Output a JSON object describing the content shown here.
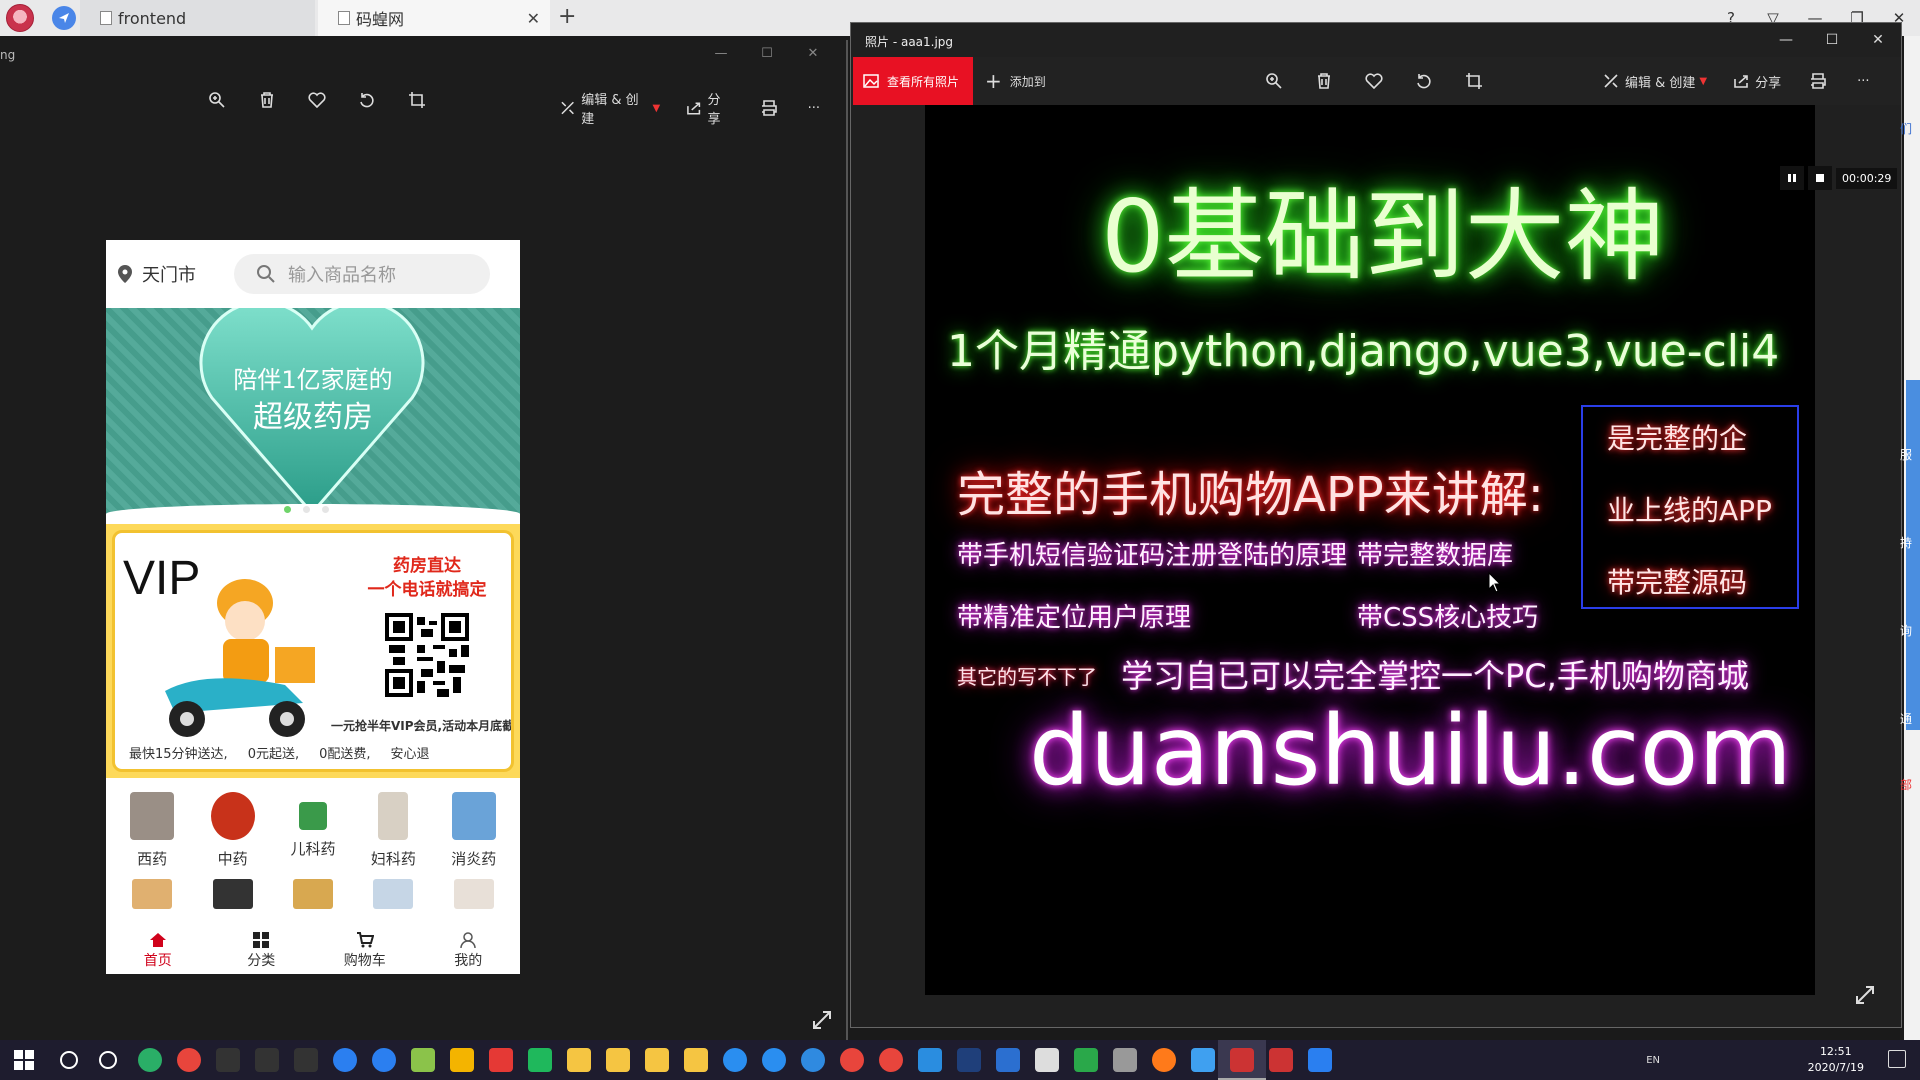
{
  "browser": {
    "tabs": [
      {
        "label": "frontend"
      },
      {
        "label": "码蝗网"
      }
    ],
    "close_label": "✕",
    "new_tab_label": "+"
  },
  "left_window": {
    "title_fragment": "ng",
    "toolbar": {
      "edit_create": "编辑 & 创建",
      "share": "分享",
      "more": "···"
    },
    "phone": {
      "location": "天门市",
      "search_placeholder": "输入商品名称",
      "banner_line1": "陪伴1亿家庭的",
      "banner_line2": "超级药房",
      "vip": {
        "title": "VIP",
        "headline1": "药房直达",
        "headline2": "一个电话就搞定",
        "promo": "一元抢半年VIP会员,活动本月底截止",
        "perks": [
          "最快15分钟送达,",
          "0元起送,",
          "0配送费,",
          "安心退"
        ]
      },
      "categories": [
        {
          "label": "西药",
          "color": "#9a8f86"
        },
        {
          "label": "中药",
          "color": "#c8321a"
        },
        {
          "label": "儿科药",
          "color": "#3a9a4a"
        },
        {
          "label": "妇科药",
          "color": "#d8d0c4"
        },
        {
          "label": "消炎药",
          "color": "#6aa3d8"
        }
      ],
      "nav": [
        {
          "label": "首页",
          "icon": "home-icon"
        },
        {
          "label": "分类",
          "icon": "grid-icon"
        },
        {
          "label": "购物车",
          "icon": "cart-icon"
        },
        {
          "label": "我的",
          "icon": "user-icon"
        }
      ]
    }
  },
  "right_window": {
    "title": "照片 - aaa1.jpg",
    "toolbar": {
      "view_all": "查看所有照片",
      "add_to": "添加到",
      "edit_create": "编辑 & 创建",
      "share": "分享",
      "more": "···"
    },
    "video_time": "00:00:29",
    "poster": {
      "title": "0基础到大神",
      "subtitle": "1个月精通python,django,vue3,vue-cli4",
      "app_line": "完整的手机购物APP来讲解:",
      "feature1": "带手机短信验证码注册登陆的原理",
      "feature2": "带完整数据库",
      "feature3": "带精准定位用户原理",
      "feature4": "带CSS核心技巧",
      "other": "其它的写不下了",
      "learn": "学习自已可以完全掌控一个PC,手机购物商城",
      "url": "duanshuilu.com",
      "box_line1": "是完整的企",
      "box_line2": "业上线的APP",
      "box_line3": "带完整源码"
    }
  },
  "edge_labels": [
    "们",
    "服",
    "持",
    "询",
    "通",
    "部"
  ],
  "taskbar": {
    "time": "12:51",
    "date": "2020/7/19",
    "lang": "EN",
    "icons": [
      {
        "name": "search-icon",
        "color": "#ffffff"
      },
      {
        "name": "task-view-icon",
        "color": "#ffffff"
      },
      {
        "name": "wechat-icon",
        "color": "#2aae67"
      },
      {
        "name": "chrome-icon",
        "color": "#e8453c"
      },
      {
        "name": "terminal-icon",
        "color": "#333333"
      },
      {
        "name": "terminal-icon",
        "color": "#333333"
      },
      {
        "name": "terminal-icon",
        "color": "#333333"
      },
      {
        "name": "qq-browser-icon",
        "color": "#2b7ff0"
      },
      {
        "name": "qq-browser-icon",
        "color": "#2b7ff0"
      },
      {
        "name": "notepad-icon",
        "color": "#8bc34a"
      },
      {
        "name": "windows-store-icon",
        "color": "#f4b400"
      },
      {
        "name": "app-red-icon",
        "color": "#e53935"
      },
      {
        "name": "vscode-green-icon",
        "color": "#1fb85c"
      },
      {
        "name": "folder-icon",
        "color": "#f5c542"
      },
      {
        "name": "folder-icon",
        "color": "#f5c542"
      },
      {
        "name": "folder-icon",
        "color": "#f5c542"
      },
      {
        "name": "folder-icon",
        "color": "#f5c542"
      },
      {
        "name": "sogou-icon",
        "color": "#2a8ef0"
      },
      {
        "name": "sogou-icon",
        "color": "#2a8ef0"
      },
      {
        "name": "ie-icon",
        "color": "#2f8ae0"
      },
      {
        "name": "chrome-icon",
        "color": "#e8453c"
      },
      {
        "name": "chrome-icon",
        "color": "#e8453c"
      },
      {
        "name": "vscode-icon",
        "color": "#2a8de0"
      },
      {
        "name": "photoshop-icon",
        "color": "#1f3f7a"
      },
      {
        "name": "word-icon",
        "color": "#2b6fd0"
      },
      {
        "name": "chat-icon",
        "color": "#dddddd"
      },
      {
        "name": "hbuilder-icon",
        "color": "#2aa84a"
      },
      {
        "name": "spider-icon",
        "color": "#999999"
      },
      {
        "name": "firefox-icon",
        "color": "#ff7a1a"
      },
      {
        "name": "cloud-icon",
        "color": "#3fa0f0"
      },
      {
        "name": "photos-icon",
        "color": "#c33"
      },
      {
        "name": "photos-icon",
        "color": "#c33"
      },
      {
        "name": "media-player-icon",
        "color": "#2a7ff0"
      }
    ]
  }
}
